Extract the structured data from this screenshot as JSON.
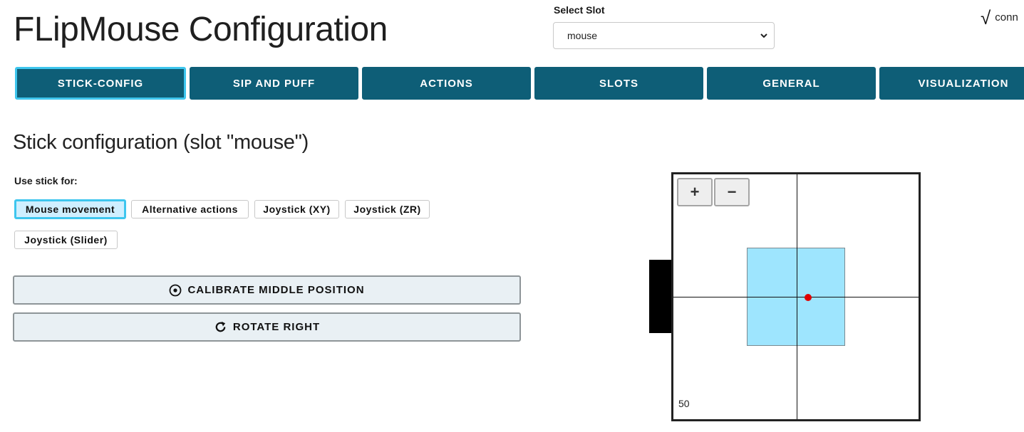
{
  "header": {
    "title": "FLipMouse Configuration",
    "slot_label": "Select Slot",
    "slot_selected": "mouse",
    "connection": {
      "check_glyph": "√",
      "text": "conn"
    }
  },
  "tabs": [
    {
      "label": "STICK-CONFIG",
      "active": true
    },
    {
      "label": "SIP AND PUFF"
    },
    {
      "label": "ACTIONS"
    },
    {
      "label": "SLOTS"
    },
    {
      "label": "GENERAL"
    },
    {
      "label": "VISUALIZATION"
    }
  ],
  "stick": {
    "title": "Stick configuration (slot \"mouse\")",
    "use_label": "Use stick for:",
    "modes": [
      {
        "label": "Mouse movement",
        "active": true
      },
      {
        "label": "Alternative actions"
      },
      {
        "label": "Joystick (XY)"
      },
      {
        "label": "Joystick (ZR)"
      },
      {
        "label": "Joystick (Slider)"
      }
    ],
    "calibrate_label": "CALIBRATE MIDDLE POSITION",
    "rotate_label": "ROTATE RIGHT"
  },
  "visualization": {
    "zoom_in": "+",
    "zoom_out": "−",
    "zoom_level": "50"
  },
  "colors": {
    "tab_bg": "#0e5e77",
    "active_accent": "#3ec6ee",
    "deadzone": "#9ee5fe",
    "cursor": "#e00000"
  }
}
